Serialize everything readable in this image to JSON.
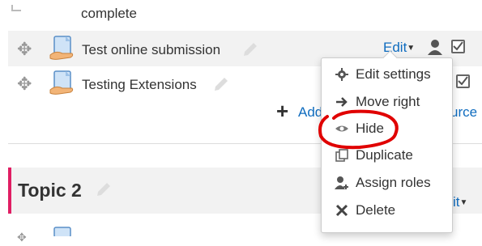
{
  "activities": [
    {
      "label": "complete"
    },
    {
      "label": "Test online submission",
      "edit": "Edit"
    },
    {
      "label": "Testing Extensions"
    }
  ],
  "add_resource": {
    "label_left": "Add",
    "label_right": "urce"
  },
  "topic2": {
    "title": "Topic 2",
    "edit_partial": "it"
  },
  "menu": {
    "items": [
      {
        "label": "Edit settings",
        "icon": "gear-icon"
      },
      {
        "label": "Move right",
        "icon": "arrow-right-icon"
      },
      {
        "label": "Hide",
        "icon": "eye-icon"
      },
      {
        "label": "Duplicate",
        "icon": "duplicate-icon"
      },
      {
        "label": "Assign roles",
        "icon": "user-plus-icon"
      },
      {
        "label": "Delete",
        "icon": "x-icon"
      }
    ]
  },
  "colors": {
    "annotation": "#e00000",
    "link": "#0f6cbf",
    "topic_accent": "#e01e63"
  }
}
